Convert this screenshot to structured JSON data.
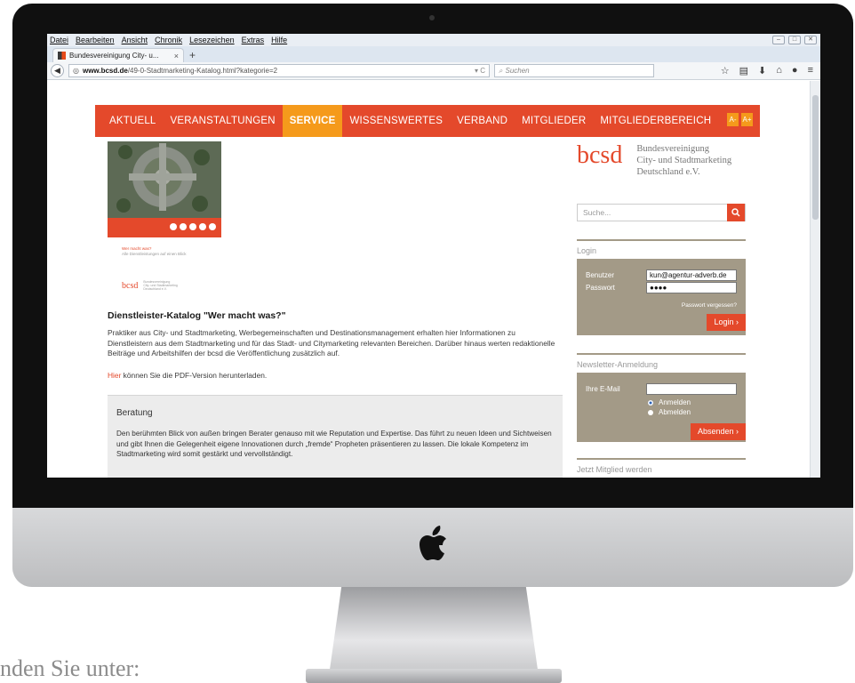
{
  "browser": {
    "menu": [
      "Datei",
      "Bearbeiten",
      "Ansicht",
      "Chronik",
      "Lesezeichen",
      "Extras",
      "Hilfe"
    ],
    "tab_title": "Bundesvereinigung City- u...",
    "tab_close": "×",
    "new_tab": "+",
    "url_domain": "www.bcsd.de",
    "url_path": "/49-0-Stadtmarketing-Katalog.html?kategorie=2",
    "search_placeholder": "Suchen"
  },
  "site": {
    "accent_color": "#e4492b",
    "active_color": "#f59a1b",
    "panel_color": "#a39a87",
    "nav": [
      "AKTUELL",
      "VERANSTALTUNGEN",
      "SERVICE",
      "WISSENSWERTES",
      "VERBAND",
      "MITGLIEDER",
      "MITGLIEDERBEREICH"
    ],
    "active_nav": "SERVICE",
    "font_smaller": "A-",
    "font_larger": "A+",
    "logo": "bcsd",
    "logo_lines": [
      "Bundesvereinigung",
      "City- und Stadtmarketing",
      "Deutschland e.V."
    ],
    "search_placeholder": "Suche...",
    "thumb_heading": "Wer macht was?",
    "thumb_sub": "Alle Dienstleistungen auf einen Blick"
  },
  "article": {
    "title": "Dienstleister-Katalog \"Wer macht was?\"",
    "body": "Praktiker aus City- und Stadtmarketing, Werbegemeinschaften und Destinationsmanagement erhalten hier Informationen zu Dienstleistern aus dem Stadtmarketing und für das Stadt- und Citymarketing relevanten Bereichen. Darüber hinaus werten redaktionelle Beiträge und Arbeitshilfen der bcsd die Veröffentlichung zusätzlich auf.",
    "pdf_link": "Hier",
    "pdf_text": " können Sie die PDF-Version herunterladen.",
    "section_title": "Beratung",
    "section_body": "Den berühmten Blick von außen bringen Berater genauso mit wie Reputation und Expertise. Das führt zu neuen Ideen und Sichtweisen und gibt Ihnen die Gelegenheit eigene Innovationen durch „fremde“ Propheten präsentieren zu lassen. Die lokale Kompetenz im Stadtmarketing wird somit gestärkt und vervollständigt."
  },
  "login": {
    "heading": "Login",
    "user_label": "Benutzer",
    "user_value": "kun@agentur-adverb.de",
    "pass_label": "Passwort",
    "pass_value": "●●●●",
    "forgot": "Passwort vergessen?",
    "button": "Login"
  },
  "newsletter": {
    "heading": "Newsletter-Anmeldung",
    "email_label": "Ihre E-Mail",
    "subscribe": "Anmelden",
    "unsubscribe": "Abmelden",
    "selected": "Anmelden",
    "button": "Absenden"
  },
  "membership": {
    "heading": "Jetzt Mitglied werden"
  },
  "caption": "nden Sie unter:"
}
